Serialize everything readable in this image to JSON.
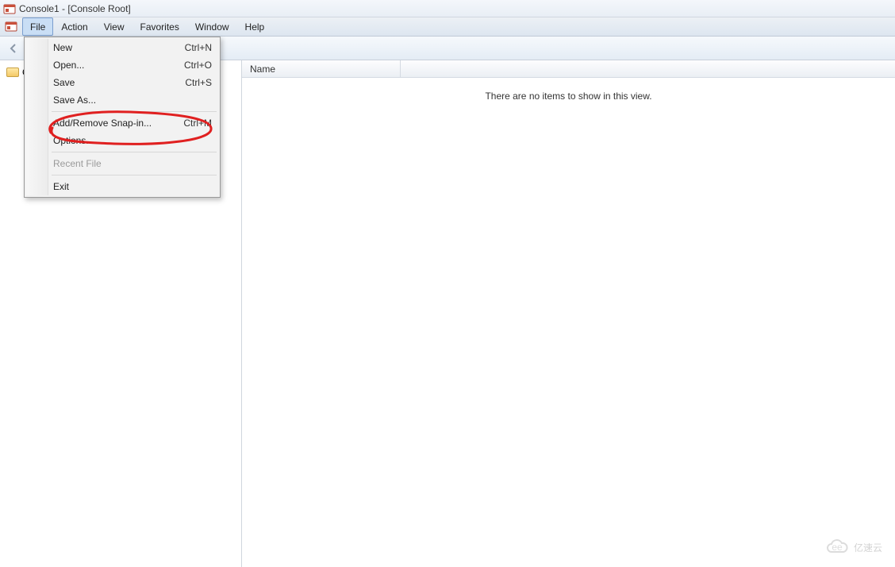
{
  "window": {
    "title": "Console1 - [Console Root]"
  },
  "menubar": {
    "items": [
      {
        "label": "File",
        "active": true
      },
      {
        "label": "Action",
        "active": false
      },
      {
        "label": "View",
        "active": false
      },
      {
        "label": "Favorites",
        "active": false
      },
      {
        "label": "Window",
        "active": false
      },
      {
        "label": "Help",
        "active": false
      }
    ]
  },
  "file_menu": {
    "groups": [
      [
        {
          "label": "New",
          "shortcut": "Ctrl+N",
          "enabled": true
        },
        {
          "label": "Open...",
          "shortcut": "Ctrl+O",
          "enabled": true
        },
        {
          "label": "Save",
          "shortcut": "Ctrl+S",
          "enabled": true
        },
        {
          "label": "Save As...",
          "shortcut": "",
          "enabled": true
        }
      ],
      [
        {
          "label": "Add/Remove Snap-in...",
          "shortcut": "Ctrl+M",
          "enabled": true
        },
        {
          "label": "Options...",
          "shortcut": "",
          "enabled": true
        }
      ],
      [
        {
          "label": "Recent File",
          "shortcut": "",
          "enabled": false
        }
      ],
      [
        {
          "label": "Exit",
          "shortcut": "",
          "enabled": true
        }
      ]
    ]
  },
  "tree": {
    "root_label": "Console Root"
  },
  "list": {
    "columns": [
      {
        "label": "Name"
      }
    ],
    "empty_message": "There are no items to show in this view."
  },
  "watermark": {
    "text": "亿速云"
  }
}
